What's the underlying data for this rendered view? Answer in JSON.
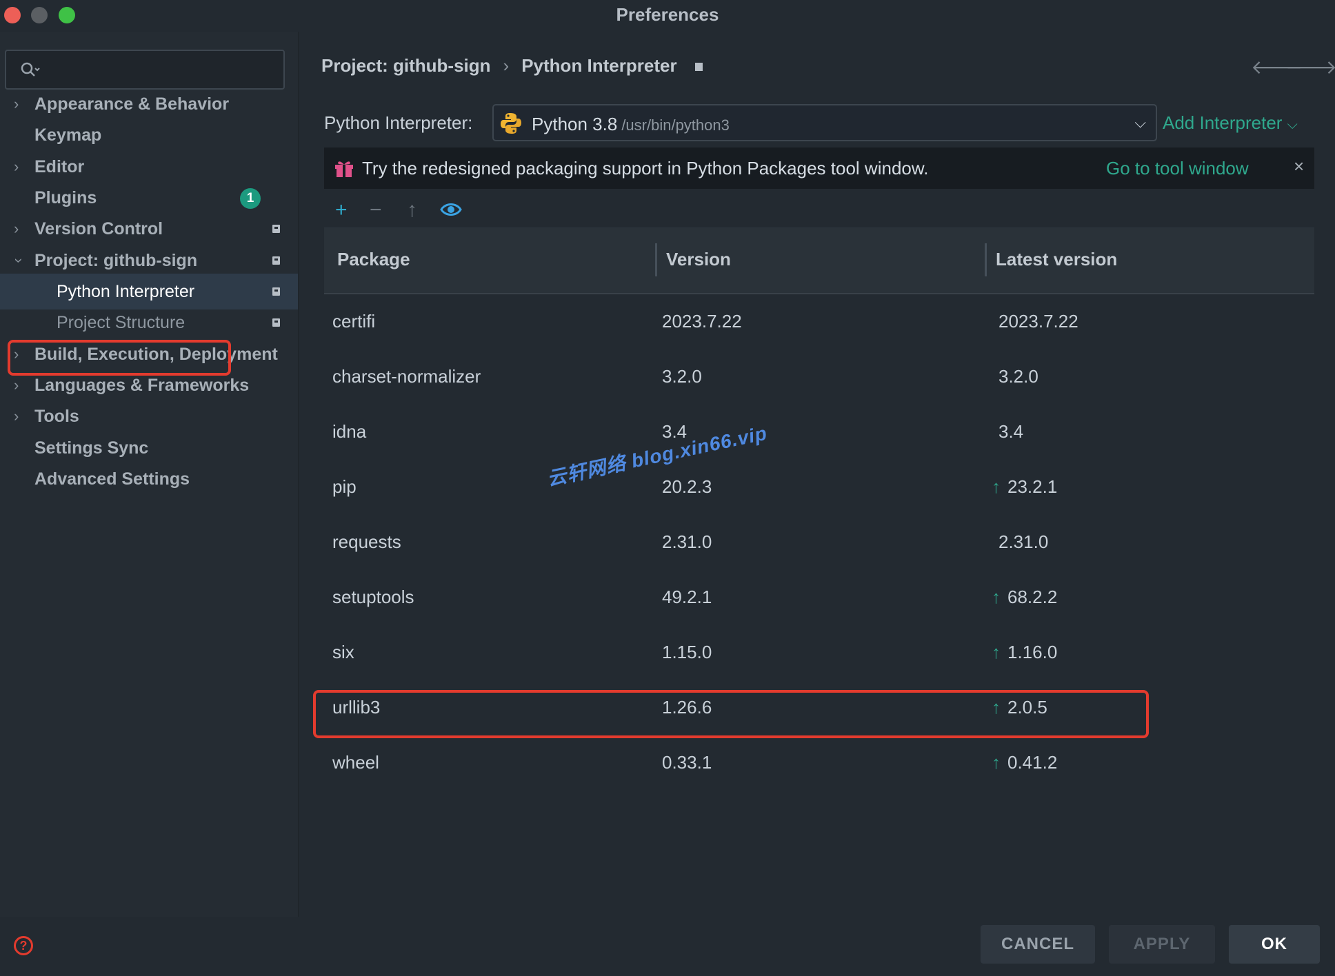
{
  "window": {
    "title": "Preferences"
  },
  "search": {
    "placeholder": ""
  },
  "sidebar": {
    "items": [
      {
        "label": "Appearance & Behavior",
        "expandable": "collapsed"
      },
      {
        "label": "Keymap"
      },
      {
        "label": "Editor",
        "expandable": "collapsed"
      },
      {
        "label": "Plugins",
        "badge": "1"
      },
      {
        "label": "Version Control",
        "expandable": "collapsed"
      },
      {
        "label": "Project: github-sign",
        "expandable": "expanded"
      },
      {
        "label": "Python Interpreter",
        "selected": true
      },
      {
        "label": "Project Structure"
      },
      {
        "label": "Build, Execution, Deployment",
        "expandable": "collapsed"
      },
      {
        "label": "Languages & Frameworks",
        "expandable": "collapsed"
      },
      {
        "label": "Tools",
        "expandable": "collapsed"
      },
      {
        "label": "Settings Sync"
      },
      {
        "label": "Advanced Settings"
      }
    ]
  },
  "breadcrumb": {
    "parent": "Project: github-sign",
    "separator": "›",
    "current": "Python Interpreter"
  },
  "interpreter": {
    "label": "Python Interpreter:",
    "name": "Python 3.8",
    "path": "/usr/bin/python3",
    "add_label": "Add Interpreter"
  },
  "banner": {
    "text": "Try the redesigned packaging support in Python Packages tool window.",
    "link": "Go to tool window",
    "close": "×"
  },
  "toolbar": {
    "add": "+",
    "remove": "−",
    "upgrade": "↑"
  },
  "table": {
    "headers": {
      "package": "Package",
      "version": "Version",
      "latest": "Latest version"
    },
    "rows": [
      {
        "package": "certifi",
        "version": "2023.7.22",
        "latest": "2023.7.22",
        "upgrade": ""
      },
      {
        "package": "charset-normalizer",
        "version": "3.2.0",
        "latest": "3.2.0",
        "upgrade": ""
      },
      {
        "package": "idna",
        "version": "3.4",
        "latest": "3.4",
        "upgrade": ""
      },
      {
        "package": "pip",
        "version": "20.2.3",
        "latest": "23.2.1",
        "upgrade": "↑"
      },
      {
        "package": "requests",
        "version": "2.31.0",
        "latest": "2.31.0",
        "upgrade": ""
      },
      {
        "package": "setuptools",
        "version": "49.2.1",
        "latest": "68.2.2",
        "upgrade": "↑"
      },
      {
        "package": "six",
        "version": "1.15.0",
        "latest": "1.16.0",
        "upgrade": "↑"
      },
      {
        "package": "urllib3",
        "version": "1.26.6",
        "latest": "2.0.5",
        "upgrade": "↑"
      },
      {
        "package": "wheel",
        "version": "0.33.1",
        "latest": "0.41.2",
        "upgrade": "↑"
      }
    ]
  },
  "watermark": "云轩网络  blog.xin66.vip",
  "footer": {
    "help": "?",
    "cancel": "CANCEL",
    "apply": "APPLY",
    "ok": "OK"
  },
  "colors": {
    "accent": "#2fa88d",
    "highlight": "#e33b2e",
    "background": "#232a31",
    "selected": "#2e3b49"
  }
}
